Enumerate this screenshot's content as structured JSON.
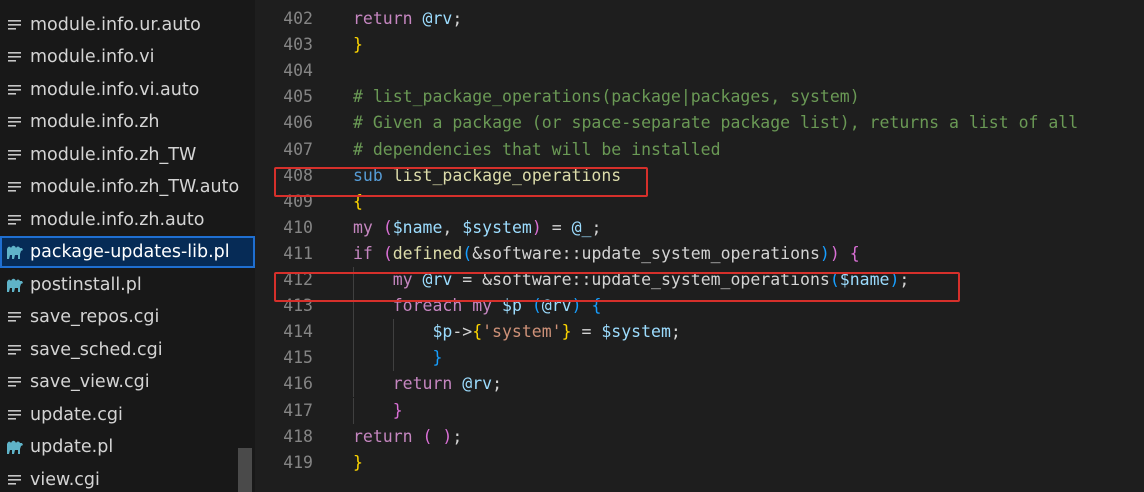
{
  "sidebar": {
    "files": [
      {
        "name": "module.info.ur.auto",
        "icon": "text-file-icon"
      },
      {
        "name": "module.info.vi",
        "icon": "text-file-icon"
      },
      {
        "name": "module.info.vi.auto",
        "icon": "text-file-icon"
      },
      {
        "name": "module.info.zh",
        "icon": "text-file-icon"
      },
      {
        "name": "module.info.zh_TW",
        "icon": "text-file-icon"
      },
      {
        "name": "module.info.zh_TW.auto",
        "icon": "text-file-icon"
      },
      {
        "name": "module.info.zh.auto",
        "icon": "text-file-icon"
      },
      {
        "name": "package-updates-lib.pl",
        "icon": "perl-camel-icon",
        "selected": true
      },
      {
        "name": "postinstall.pl",
        "icon": "perl-camel-icon"
      },
      {
        "name": "save_repos.cgi",
        "icon": "text-file-icon"
      },
      {
        "name": "save_sched.cgi",
        "icon": "text-file-icon"
      },
      {
        "name": "save_view.cgi",
        "icon": "text-file-icon"
      },
      {
        "name": "update.cgi",
        "icon": "text-file-icon"
      },
      {
        "name": "update.pl",
        "icon": "perl-camel-icon"
      },
      {
        "name": "view.cgi",
        "icon": "text-file-icon"
      }
    ]
  },
  "editor": {
    "lines": [
      {
        "num": "402",
        "tokens": [
          [
            "t-kw",
            "return "
          ],
          [
            "t-var",
            "@rv"
          ],
          [
            "t-op",
            ";"
          ]
        ]
      },
      {
        "num": "403",
        "tokens": [
          [
            "t-b1",
            "}"
          ]
        ]
      },
      {
        "num": "404",
        "tokens": []
      },
      {
        "num": "405",
        "tokens": [
          [
            "t-cm",
            "# list_package_operations(package|packages, system)"
          ]
        ]
      },
      {
        "num": "406",
        "tokens": [
          [
            "t-cm",
            "# Given a package (or space-separate package list), returns a list of all"
          ]
        ]
      },
      {
        "num": "407",
        "tokens": [
          [
            "t-cm",
            "# dependencies that will be installed"
          ]
        ]
      },
      {
        "num": "408",
        "tokens": [
          [
            "t-sub",
            "sub "
          ],
          [
            "t-fn",
            "list_package_operations"
          ]
        ],
        "highlight": true
      },
      {
        "num": "409",
        "tokens": [
          [
            "t-b1",
            "{"
          ]
        ]
      },
      {
        "num": "410",
        "tokens": [
          [
            "t-kw",
            "my "
          ],
          [
            "t-b2",
            "("
          ],
          [
            "t-var",
            "$name"
          ],
          [
            "t-op",
            ", "
          ],
          [
            "t-var",
            "$system"
          ],
          [
            "t-b2",
            ")"
          ],
          [
            "t-op",
            " = "
          ],
          [
            "t-var",
            "@_"
          ],
          [
            "t-op",
            ";"
          ]
        ]
      },
      {
        "num": "411",
        "tokens": [
          [
            "t-kw",
            "if "
          ],
          [
            "t-b2",
            "("
          ],
          [
            "t-fn",
            "defined"
          ],
          [
            "t-b3",
            "("
          ],
          [
            "t-op",
            "&software::update_system_operations"
          ],
          [
            "t-b3",
            ")"
          ],
          [
            "t-b2",
            ")"
          ],
          [
            "t-op",
            " "
          ],
          [
            "t-b2",
            "{"
          ]
        ]
      },
      {
        "num": "412",
        "indent": 1,
        "tokens": [
          [
            "t-kw",
            "my "
          ],
          [
            "t-var",
            "@rv"
          ],
          [
            "t-op",
            " = &software::update_system_operations"
          ],
          [
            "t-b3",
            "("
          ],
          [
            "t-var",
            "$name"
          ],
          [
            "t-b3",
            ")"
          ],
          [
            "t-op",
            ";"
          ]
        ],
        "highlight": true
      },
      {
        "num": "413",
        "indent": 1,
        "tokens": [
          [
            "t-kw",
            "foreach "
          ],
          [
            "t-kw",
            "my "
          ],
          [
            "t-var",
            "$p"
          ],
          [
            "t-op",
            " "
          ],
          [
            "t-b3",
            "("
          ],
          [
            "t-var",
            "@rv"
          ],
          [
            "t-b3",
            ")"
          ],
          [
            "t-op",
            " "
          ],
          [
            "t-b3",
            "{"
          ]
        ]
      },
      {
        "num": "414",
        "indent": 2,
        "tokens": [
          [
            "t-var",
            "$p"
          ],
          [
            "t-op",
            "->"
          ],
          [
            "t-b1",
            "{"
          ],
          [
            "t-str",
            "'system'"
          ],
          [
            "t-b1",
            "}"
          ],
          [
            "t-op",
            " = "
          ],
          [
            "t-var",
            "$system"
          ],
          [
            "t-op",
            ";"
          ]
        ]
      },
      {
        "num": "415",
        "indent": 2,
        "tokens": [
          [
            "t-b3",
            "}"
          ]
        ]
      },
      {
        "num": "416",
        "indent": 1,
        "tokens": [
          [
            "t-kw",
            "return "
          ],
          [
            "t-var",
            "@rv"
          ],
          [
            "t-op",
            ";"
          ]
        ]
      },
      {
        "num": "417",
        "indent": 1,
        "tokens": [
          [
            "t-b2",
            "}"
          ]
        ]
      },
      {
        "num": "418",
        "tokens": [
          [
            "t-kw",
            "return "
          ],
          [
            "t-b2",
            "( )"
          ],
          [
            "t-op",
            ";"
          ]
        ]
      },
      {
        "num": "419",
        "tokens": [
          [
            "t-b1",
            "}"
          ]
        ]
      }
    ]
  }
}
